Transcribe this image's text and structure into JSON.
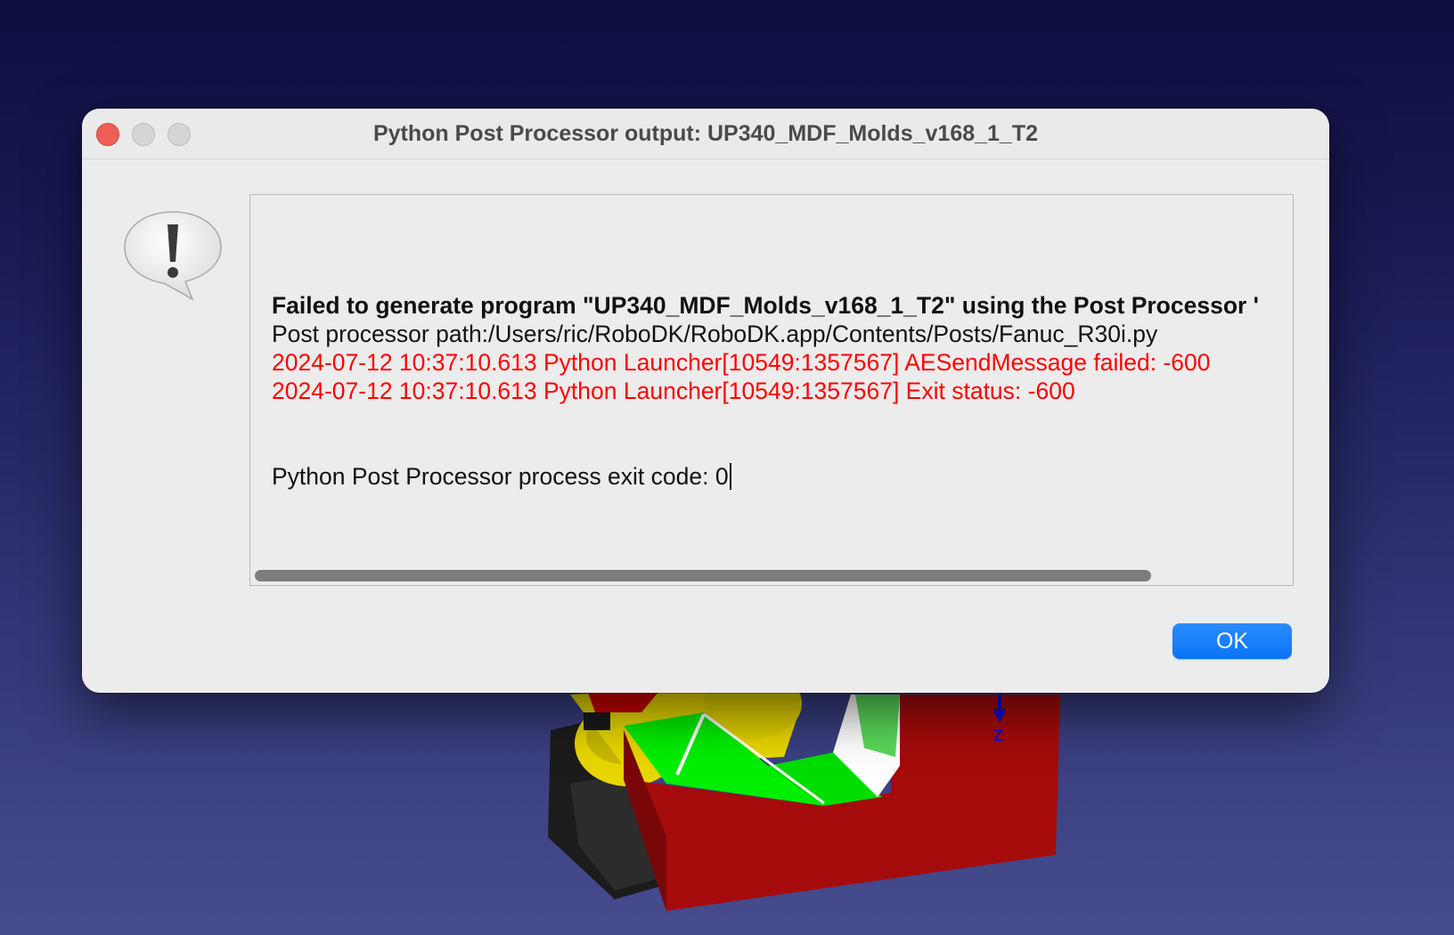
{
  "dialog": {
    "title": "Python Post Processor output: UP340_MDF_Molds_v168_1_T2",
    "icon": "warning-speech-bubble-icon",
    "output_lines": {
      "error_summary": "Failed to generate program \"UP340_MDF_Molds_v168_1_T2\" using the Post Processor '",
      "post_processor_path": "Post processor path:/Users/ric/RoboDK/RoboDK.app/Contents/Posts/Fanuc_R30i.py",
      "launcher_error_1": "2024-07-12 10:37:10.613 Python Launcher[10549:1357567] AESendMessage failed: -600",
      "launcher_error_2": "2024-07-12 10:37:10.613 Python Launcher[10549:1357567] Exit status: -600",
      "exit_code": "Python Post Processor process exit code: 0"
    },
    "ok_label": "OK"
  },
  "scene": {
    "axis_label": "Z"
  },
  "colors": {
    "accent": "#0a74f5",
    "error_text": "#ff0000",
    "close_button": "#ec5f57",
    "part_block": "#a50b0b",
    "toolpath": "#00ee00",
    "robot": "#e8d600"
  }
}
